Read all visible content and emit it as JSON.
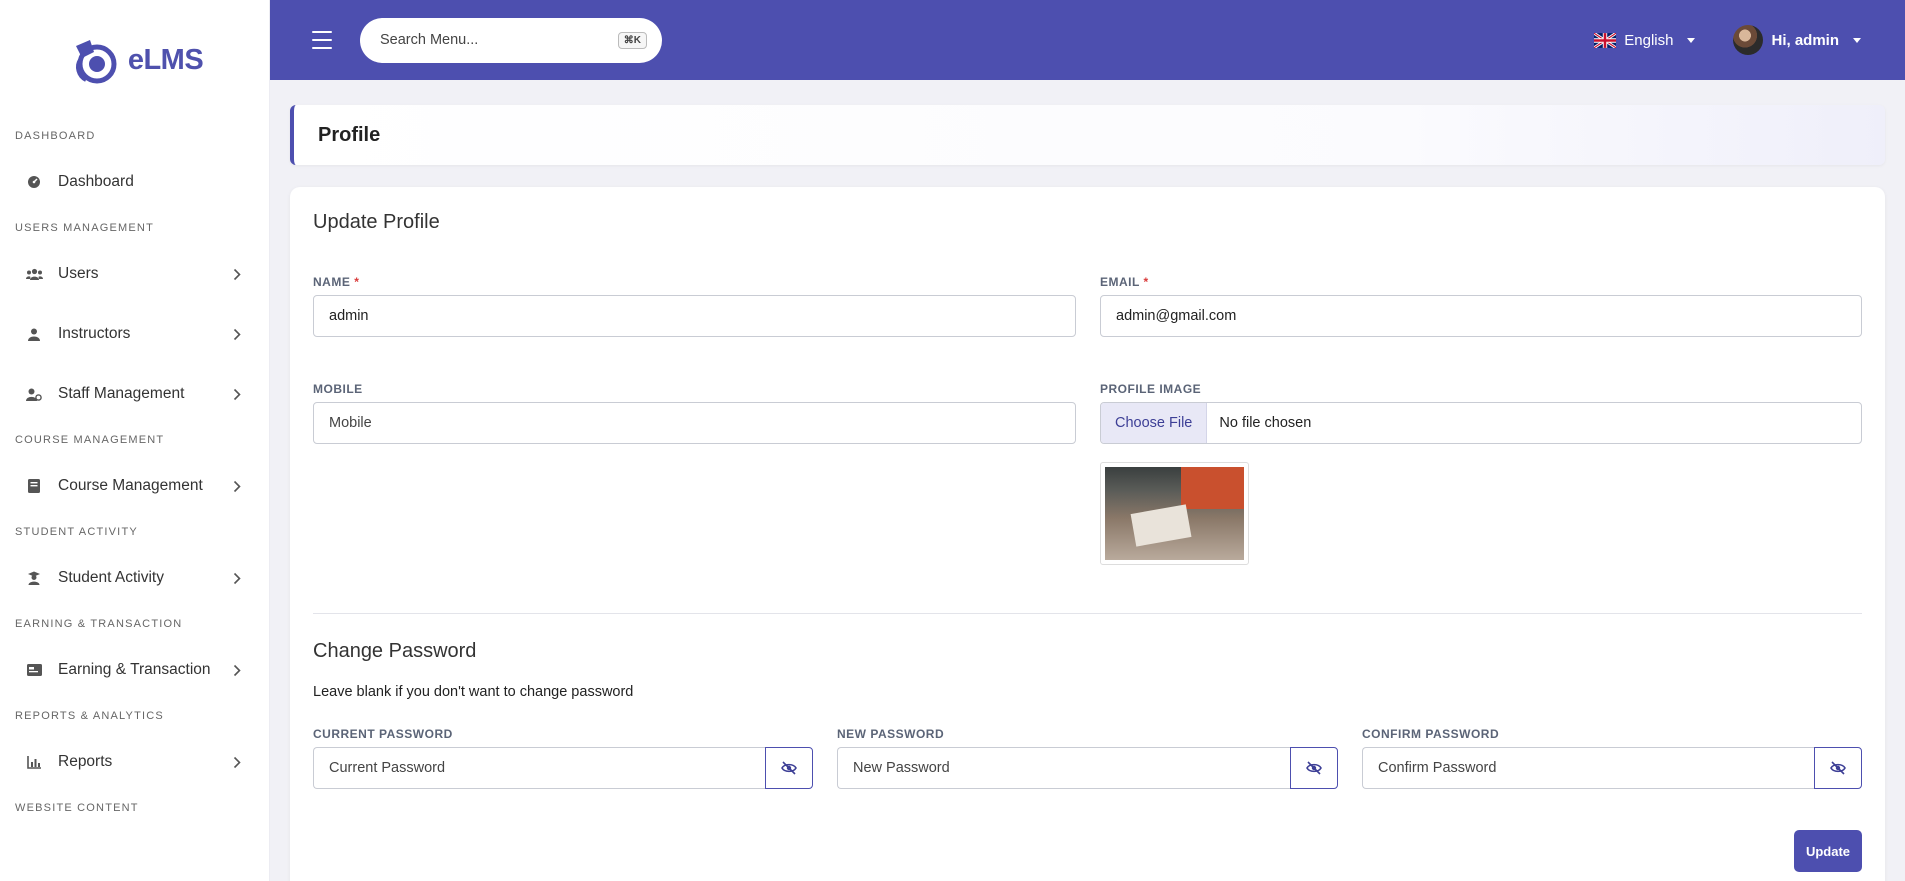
{
  "brand": {
    "name": "eLMS",
    "color": "#4d4faf"
  },
  "sidebar": {
    "sections": [
      {
        "label": "DASHBOARD",
        "items": [
          {
            "label": "Dashboard",
            "icon": "dashboard-icon",
            "chevron": false
          }
        ]
      },
      {
        "label": "USERS MANAGEMENT",
        "items": [
          {
            "label": "Users",
            "icon": "users-icon",
            "chevron": true
          },
          {
            "label": "Instructors",
            "icon": "instructor-icon",
            "chevron": true
          },
          {
            "label": "Staff Management",
            "icon": "staff-icon",
            "chevron": true
          }
        ]
      },
      {
        "label": "COURSE MANAGEMENT",
        "items": [
          {
            "label": "Course Management",
            "icon": "book-icon",
            "chevron": true
          }
        ]
      },
      {
        "label": "STUDENT ACTIVITY",
        "items": [
          {
            "label": "Student Activity",
            "icon": "student-icon",
            "chevron": true
          }
        ]
      },
      {
        "label": "EARNING & TRANSACTION",
        "items": [
          {
            "label": "Earning & Transaction",
            "icon": "wallet-icon",
            "chevron": true
          }
        ]
      },
      {
        "label": "REPORTS & ANALYTICS",
        "items": [
          {
            "label": "Reports",
            "icon": "chart-icon",
            "chevron": true
          }
        ]
      },
      {
        "label": "WEBSITE CONTENT",
        "items": []
      }
    ]
  },
  "header": {
    "search_placeholder": "Search Menu...",
    "search_shortcut": "⌘K",
    "language": "English",
    "greeting": "Hi, admin"
  },
  "page": {
    "title": "Profile",
    "update_profile_title": "Update Profile",
    "name": {
      "label": "NAME",
      "required_mark": "*",
      "value": "admin"
    },
    "email": {
      "label": "EMAIL",
      "required_mark": "*",
      "value": "admin@gmail.com"
    },
    "mobile": {
      "label": "MOBILE",
      "placeholder": "Mobile",
      "value": ""
    },
    "profile_image": {
      "label": "PROFILE IMAGE",
      "button": "Choose File",
      "status": "No file chosen"
    },
    "change_password": {
      "title": "Change Password",
      "note": "Leave blank if you don't want to change password",
      "current": {
        "label": "CURRENT PASSWORD",
        "placeholder": "Current Password"
      },
      "new": {
        "label": "NEW PASSWORD",
        "placeholder": "New Password"
      },
      "confirm": {
        "label": "CONFIRM PASSWORD",
        "placeholder": "Confirm Password"
      }
    },
    "update_button": "Update"
  }
}
